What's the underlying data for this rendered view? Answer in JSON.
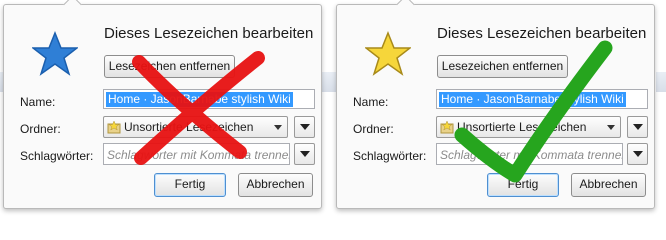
{
  "colors": {
    "star_blue": "#2f7fd6",
    "star_yellow": "#f6d63a",
    "cross_red": "#e81212",
    "check_green": "#26a51e",
    "selection_blue": "#3399ff"
  },
  "panels": [
    {
      "id": "left",
      "star_icon": "blue-star-icon",
      "marker_icon": "red-cross-icon",
      "title": "Dieses Lesezeichen bearbeiten",
      "remove_button": "Lesezeichen entfernen",
      "name_label": "Name:",
      "name_value": "Home · JasonBarnabe stylish Wiki",
      "folder_label": "Ordner:",
      "folder_value": "Unsortierte Lesezeichen",
      "tags_label": "Schlagwörter:",
      "tags_placeholder": "Schlagwörter mit Kommata trennen",
      "done_button": "Fertig",
      "cancel_button": "Abbrechen"
    },
    {
      "id": "right",
      "star_icon": "yellow-star-icon",
      "marker_icon": "green-checkmark-icon",
      "title": "Dieses Lesezeichen bearbeiten",
      "remove_button": "Lesezeichen entfernen",
      "name_label": "Name:",
      "name_value": "Home · JasonBarnabe stylish Wiki",
      "folder_label": "Ordner:",
      "folder_value": "Unsortierte Lesezeichen",
      "tags_label": "Schlagwörter:",
      "tags_placeholder": "Schlagwörter mit Kommata trennen",
      "done_button": "Fertig",
      "cancel_button": "Abbrechen"
    }
  ]
}
